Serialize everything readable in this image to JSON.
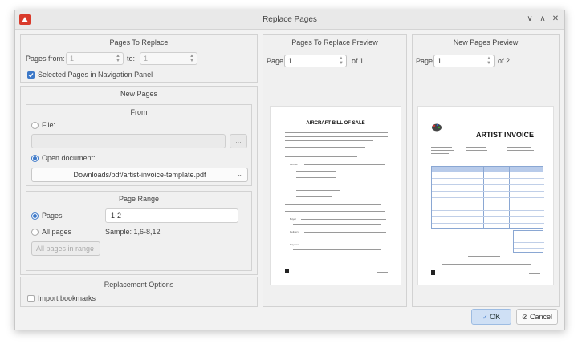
{
  "window": {
    "title": "Replace Pages",
    "controls": [
      "minimize",
      "maximize",
      "close"
    ]
  },
  "pages_to_replace": {
    "header": "Pages To Replace",
    "from_label": "Pages from:",
    "from_value": "1",
    "to_label": "to:",
    "to_value": "1",
    "selected_pages_label": "Selected Pages in Navigation Panel",
    "selected_pages_checked": true
  },
  "new_pages": {
    "header": "New Pages",
    "from": {
      "header": "From",
      "file_label": "File:",
      "file_value": "",
      "browse_label": "...",
      "open_document_label": "Open document:",
      "open_document_value": "Downloads/pdf/artist-invoice-template.pdf",
      "selected": "open_document"
    },
    "page_range": {
      "header": "Page Range",
      "pages_label": "Pages",
      "pages_value": "1-2",
      "all_pages_label": "All pages",
      "sample_text": "Sample: 1,6-8,12",
      "subset_value": "All pages in range",
      "selected": "pages"
    }
  },
  "replacement_options": {
    "header": "Replacement Options",
    "import_bookmarks_label": "Import bookmarks",
    "import_bookmarks_checked": false
  },
  "preview_replace": {
    "header": "Pages To Replace Preview",
    "page_label": "Page",
    "page_value": "1",
    "of_text": "of 1",
    "doc": {
      "title": "AIRCRAFT BILL OF SALE",
      "items": [
        "Aircraft",
        "Buyer",
        "Delivery",
        "Payment"
      ]
    }
  },
  "preview_new": {
    "header": "New Pages Preview",
    "page_label": "Page",
    "page_value": "1",
    "of_text": "of 2",
    "doc": {
      "title": "ARTIST INVOICE"
    }
  },
  "buttons": {
    "ok": "OK",
    "cancel": "Cancel"
  },
  "colors": {
    "accent": "#3c78c8",
    "app_icon": "#d93a2b",
    "ok_bg": "#cfe0f5"
  }
}
